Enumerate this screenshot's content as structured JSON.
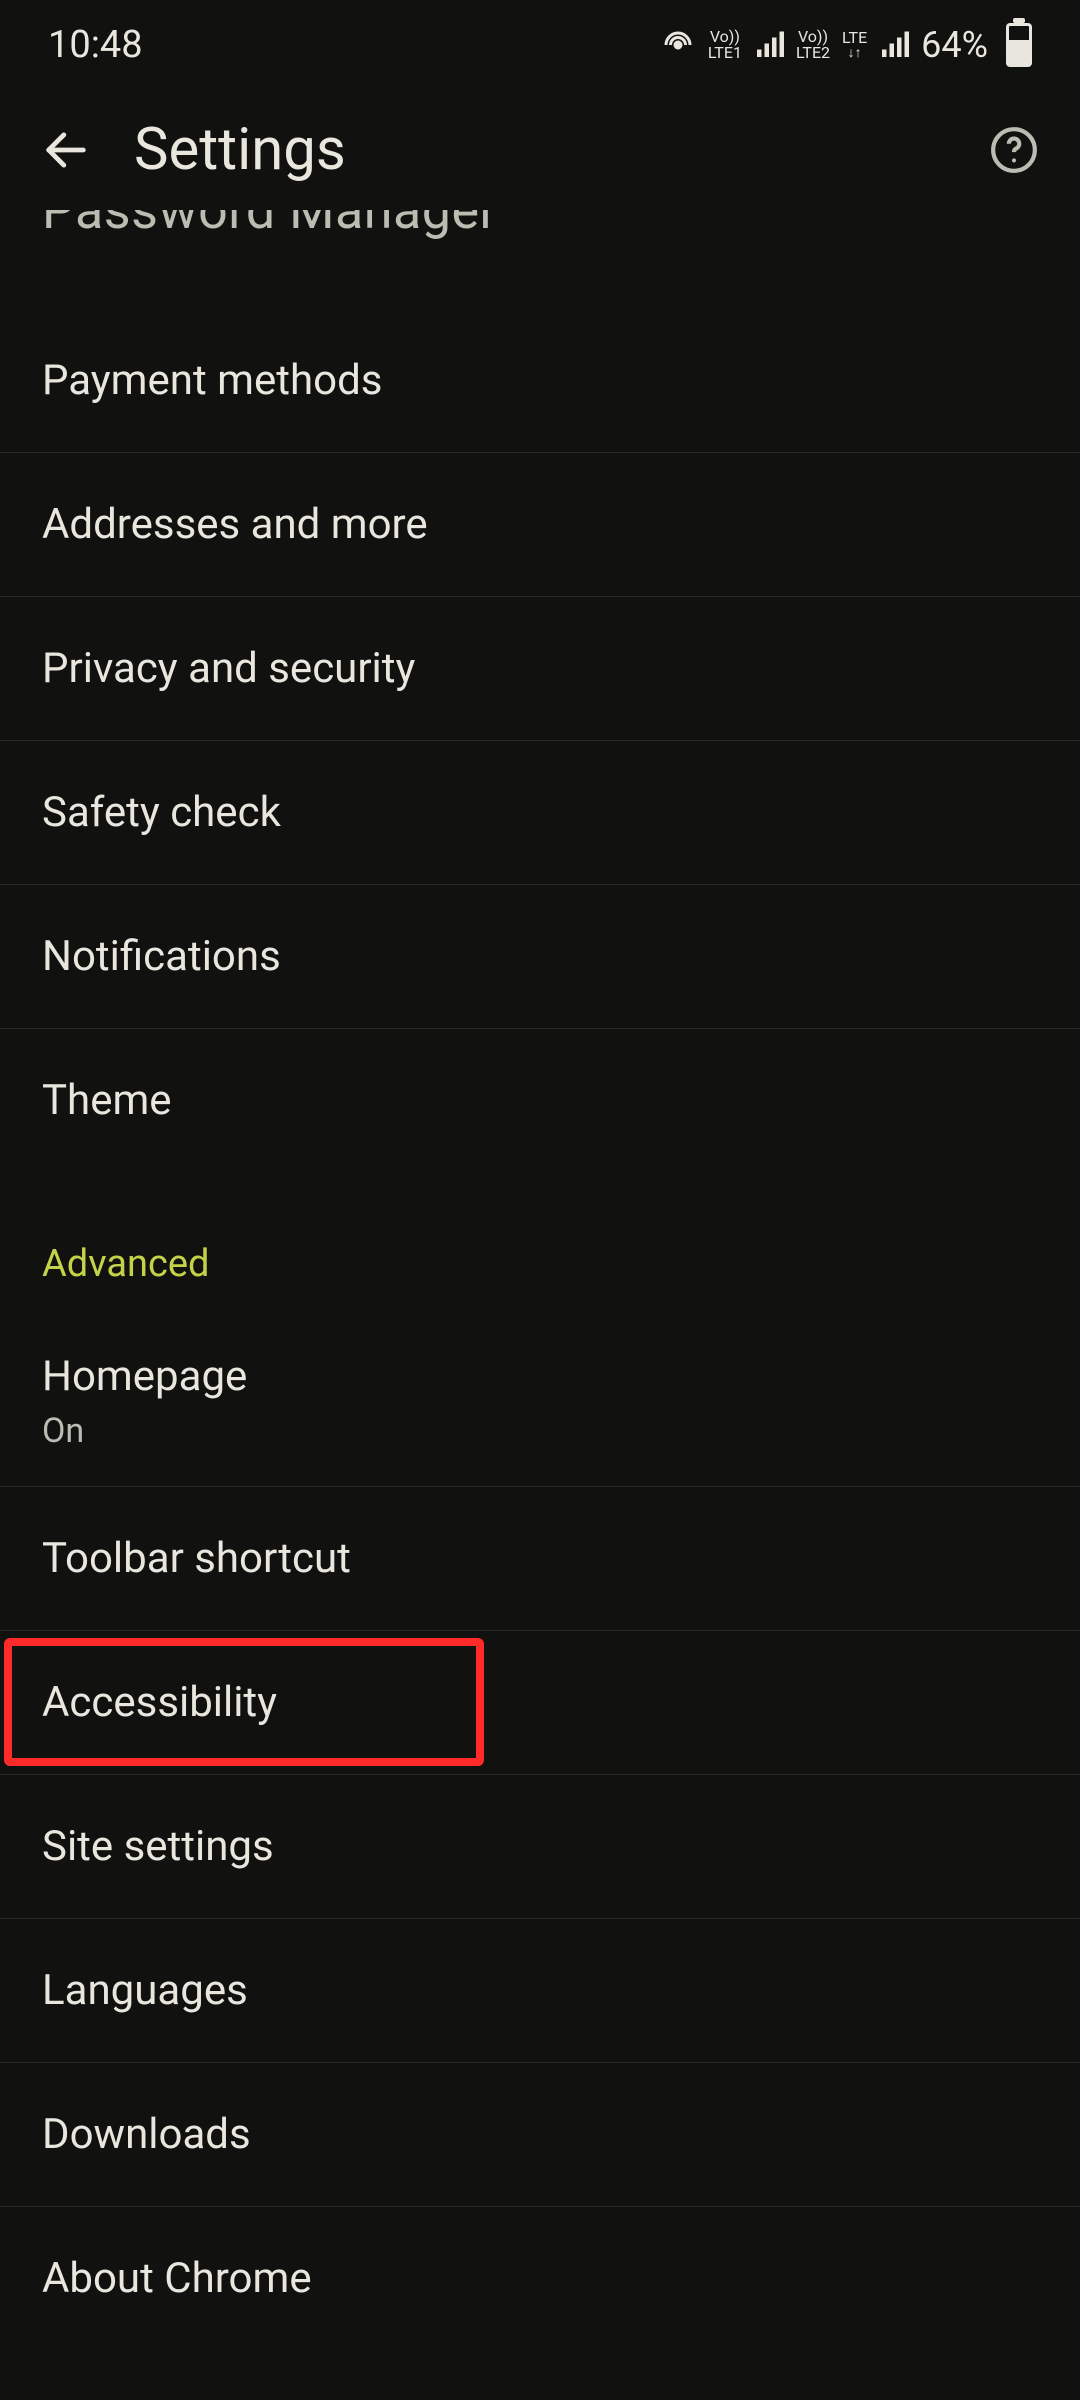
{
  "status_bar": {
    "time": "10:48",
    "sim1_label_top": "Vo))",
    "sim1_label_bottom": "LTE1",
    "sim2_label_top": "Vo))",
    "sim2_label_bottom": "LTE2",
    "lte_label": "LTE",
    "battery_text": "64%"
  },
  "app_bar": {
    "title": "Settings"
  },
  "truncated_item": {
    "title": "Password Manager"
  },
  "basics_items": [
    {
      "title": "Payment methods"
    },
    {
      "title": "Addresses and more"
    },
    {
      "title": "Privacy and security"
    },
    {
      "title": "Safety check"
    },
    {
      "title": "Notifications"
    },
    {
      "title": "Theme"
    }
  ],
  "section_header": "Advanced",
  "advanced_items": [
    {
      "title": "Homepage",
      "subtitle": "On"
    },
    {
      "title": "Toolbar shortcut"
    },
    {
      "title": "Accessibility",
      "highlighted": true
    },
    {
      "title": "Site settings"
    },
    {
      "title": "Languages"
    },
    {
      "title": "Downloads"
    },
    {
      "title": "About Chrome"
    }
  ],
  "highlight_target_index": 2
}
